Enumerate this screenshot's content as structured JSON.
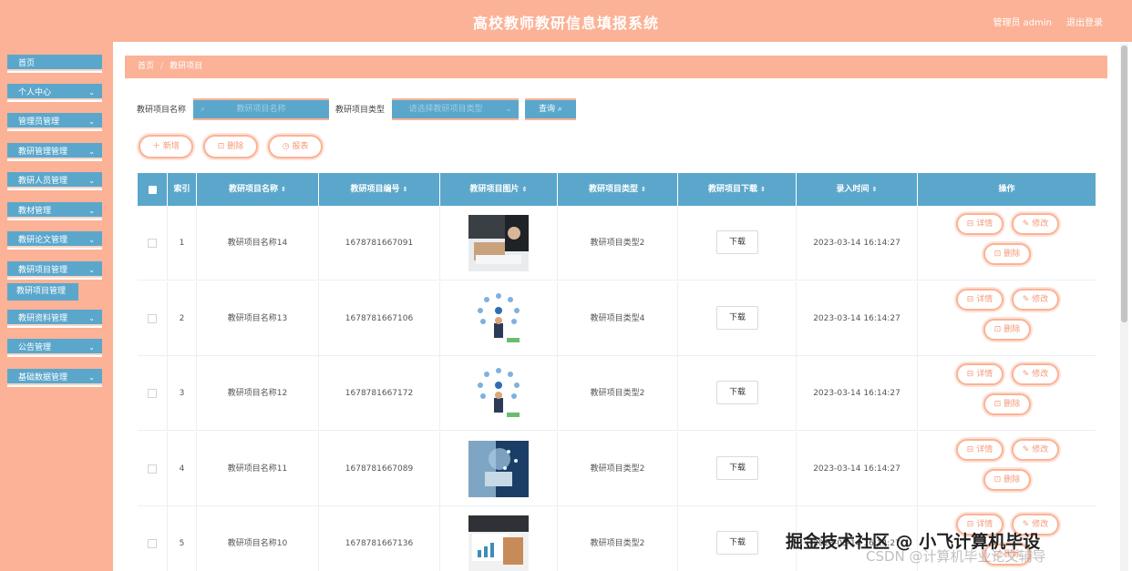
{
  "header": {
    "title": "高校教师教研信息填报系统",
    "user": "管理员 admin",
    "logout": "退出登录"
  },
  "sidebar": {
    "items": [
      {
        "label": "首页",
        "chev": ""
      },
      {
        "label": "个人中心",
        "chev": "⌄"
      },
      {
        "label": "管理员管理",
        "chev": "⌄"
      },
      {
        "label": "教研管理管理",
        "chev": "⌄"
      },
      {
        "label": "教研人员管理",
        "chev": "⌄"
      },
      {
        "label": "教材管理",
        "chev": "⌄"
      },
      {
        "label": "教研论文管理",
        "chev": "⌄"
      },
      {
        "label": "教研项目管理",
        "chev": "⌄"
      },
      {
        "label": "教研资料管理",
        "chev": "⌄"
      },
      {
        "label": "公告管理",
        "chev": "⌄"
      },
      {
        "label": "基础数据管理",
        "chev": "⌄"
      }
    ],
    "sub_item": "教研项目管理"
  },
  "breadcrumb": {
    "home": "首页",
    "sep": "/",
    "current": "教研项目"
  },
  "search": {
    "name_label": "教研项目名称",
    "name_placeholder": "教研项目名称",
    "type_label": "教研项目类型",
    "type_placeholder": "请选择教研项目类型",
    "query": "查询 ⌕"
  },
  "actions": {
    "add": "＋ 新增",
    "delete": "⊡ 删除",
    "report": "◷ 报表"
  },
  "table": {
    "headers": [
      "索引",
      "教研项目名称",
      "教研项目编号",
      "教研项目图片",
      "教研项目类型",
      "教研项目下载",
      "录入时间",
      "操作"
    ],
    "sort": "⇕",
    "download_label": "下载",
    "op_detail": "⊟ 详情",
    "op_edit": "✎ 修改",
    "op_delete": "⊡ 删除",
    "rows": [
      {
        "index": "1",
        "name": "教研项目名称14",
        "code": "1678781667091",
        "type": "教研项目类型2",
        "time": "2023-03-14 16:14:27",
        "img": "office"
      },
      {
        "index": "2",
        "name": "教研项目名称13",
        "code": "1678781667106",
        "type": "教研项目类型4",
        "time": "2023-03-14 16:14:27",
        "img": "network"
      },
      {
        "index": "3",
        "name": "教研项目名称12",
        "code": "1678781667172",
        "type": "教研项目类型2",
        "time": "2023-03-14 16:14:27",
        "img": "network"
      },
      {
        "index": "4",
        "name": "教研项目名称11",
        "code": "1678781667089",
        "type": "教研项目类型2",
        "time": "2023-03-14 16:14:27",
        "img": "tech"
      },
      {
        "index": "5",
        "name": "教研项目名称10",
        "code": "1678781667136",
        "type": "教研项目类型2",
        "time": "2023-03-14 16:14:27",
        "img": "desk"
      }
    ]
  },
  "watermark": {
    "line1": "掘金技术社区 @ 小飞计算机毕设",
    "line2": "CSDN @计算机毕业论文辅导"
  },
  "colors": {
    "accent": "#fbb296",
    "primary": "#5ba7cc"
  }
}
